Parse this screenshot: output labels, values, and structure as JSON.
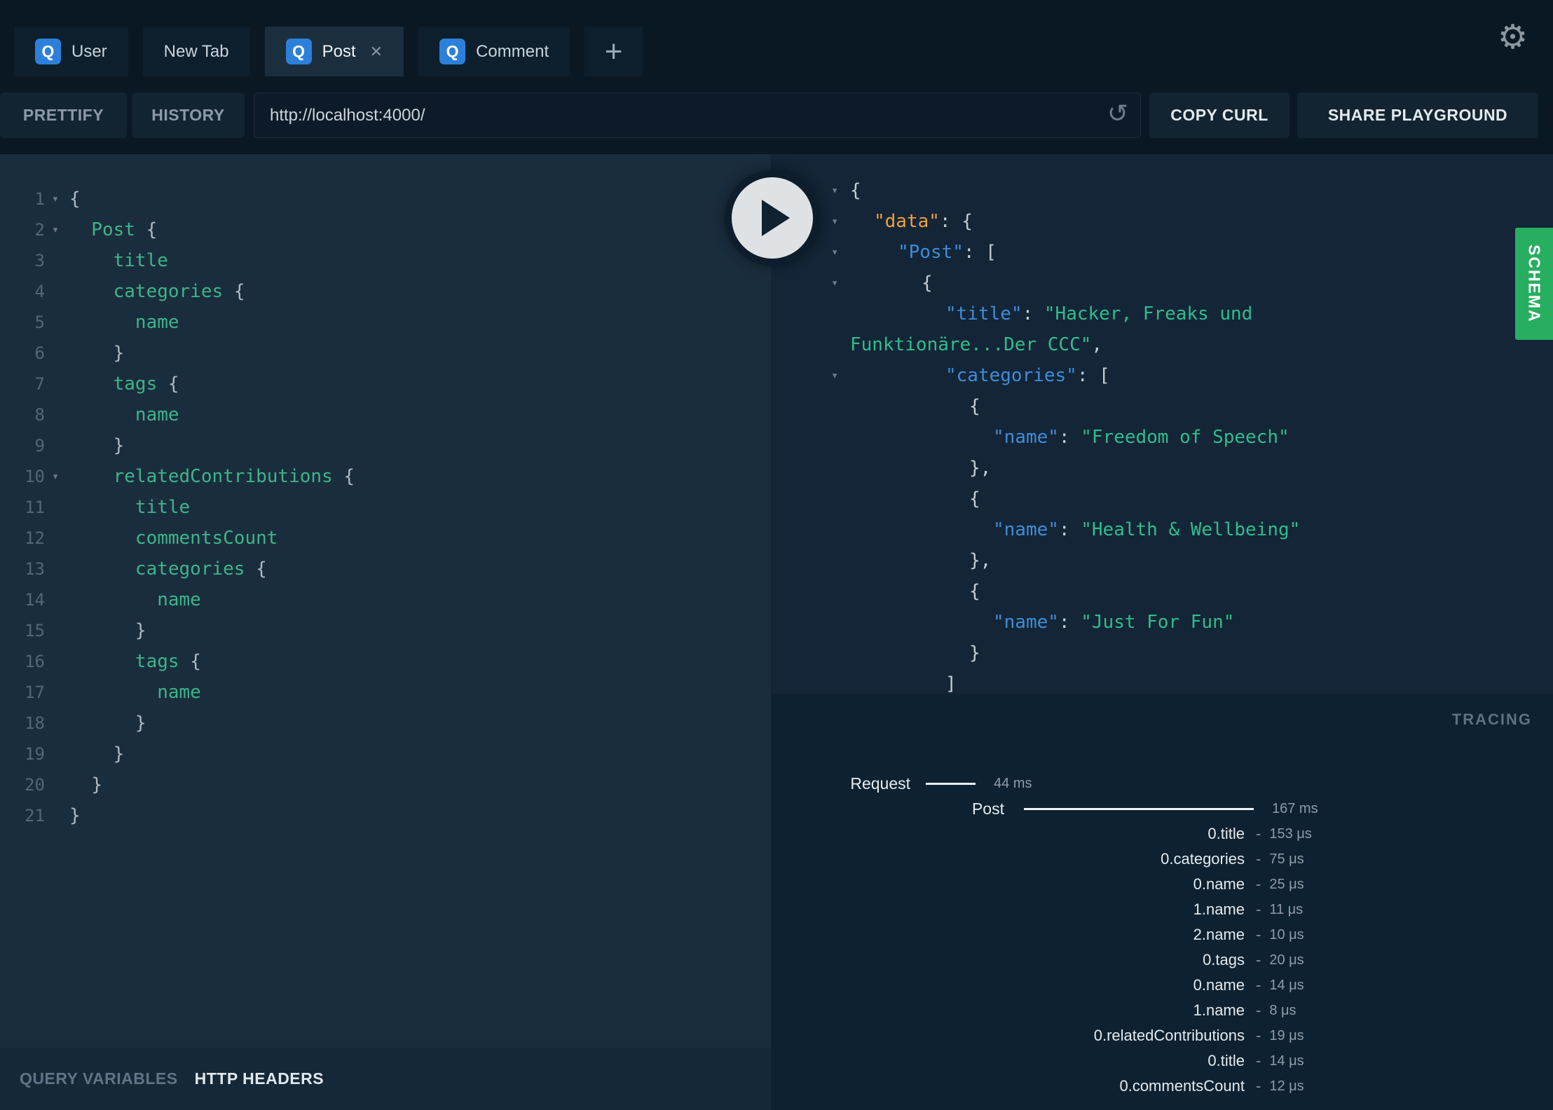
{
  "icons": {
    "gear": "⚙",
    "reload": "↺",
    "close": "✕",
    "collapse": "▾",
    "query_badge": "Q"
  },
  "tabs": [
    {
      "label": "User",
      "has_icon": true,
      "active": false,
      "closable": false
    },
    {
      "label": "New Tab",
      "has_icon": false,
      "active": false,
      "closable": false
    },
    {
      "label": "Post",
      "has_icon": true,
      "active": true,
      "closable": true
    },
    {
      "label": "Comment",
      "has_icon": true,
      "active": false,
      "closable": false
    }
  ],
  "new_tab_button": "+",
  "toolbar": {
    "prettify": "PRETTIFY",
    "history": "HISTORY",
    "url": "http://localhost:4000/",
    "copy_curl": "COPY CURL",
    "share": "SHARE PLAYGROUND"
  },
  "editor": {
    "lines": [
      {
        "n": 1,
        "arrow": true,
        "code": "{"
      },
      {
        "n": 2,
        "arrow": true,
        "code": "  Post {"
      },
      {
        "n": 3,
        "arrow": false,
        "code": "    title"
      },
      {
        "n": 4,
        "arrow": false,
        "code": "    categories {"
      },
      {
        "n": 5,
        "arrow": false,
        "code": "      name"
      },
      {
        "n": 6,
        "arrow": false,
        "code": "    }"
      },
      {
        "n": 7,
        "arrow": false,
        "code": "    tags {"
      },
      {
        "n": 8,
        "arrow": false,
        "code": "      name"
      },
      {
        "n": 9,
        "arrow": false,
        "code": "    }"
      },
      {
        "n": 10,
        "arrow": true,
        "code": "    relatedContributions {"
      },
      {
        "n": 11,
        "arrow": false,
        "code": "      title"
      },
      {
        "n": 12,
        "arrow": false,
        "code": "      commentsCount"
      },
      {
        "n": 13,
        "arrow": false,
        "code": "      categories {"
      },
      {
        "n": 14,
        "arrow": false,
        "code": "        name"
      },
      {
        "n": 15,
        "arrow": false,
        "code": "      }"
      },
      {
        "n": 16,
        "arrow": false,
        "code": "      tags {"
      },
      {
        "n": 17,
        "arrow": false,
        "code": "        name"
      },
      {
        "n": 18,
        "arrow": false,
        "code": "      }"
      },
      {
        "n": 19,
        "arrow": false,
        "code": "    }"
      },
      {
        "n": 20,
        "arrow": false,
        "code": "  }"
      },
      {
        "n": 21,
        "arrow": false,
        "code": "}"
      }
    ]
  },
  "response": {
    "lines": [
      {
        "arrow": true,
        "level": 0,
        "segs": [
          {
            "c": "p",
            "t": "{"
          }
        ]
      },
      {
        "arrow": true,
        "level": 1,
        "segs": [
          {
            "c": "kd",
            "t": "\"data\""
          },
          {
            "c": "p",
            "t": ": {"
          }
        ]
      },
      {
        "arrow": true,
        "level": 2,
        "segs": [
          {
            "c": "k",
            "t": "\"Post\""
          },
          {
            "c": "p",
            "t": ": ["
          }
        ]
      },
      {
        "arrow": true,
        "level": 3,
        "segs": [
          {
            "c": "p",
            "t": "{"
          }
        ]
      },
      {
        "arrow": false,
        "level": 4,
        "segs": [
          {
            "c": "k",
            "t": "\"title\""
          },
          {
            "c": "p",
            "t": ": "
          },
          {
            "c": "v",
            "t": "\"Hacker, Freaks und"
          }
        ]
      },
      {
        "arrow": false,
        "level": 0,
        "segs": [
          {
            "c": "v",
            "t": "Funktionäre...Der CCC\""
          },
          {
            "c": "p",
            "t": ","
          }
        ]
      },
      {
        "arrow": true,
        "level": 4,
        "segs": [
          {
            "c": "k",
            "t": "\"categories\""
          },
          {
            "c": "p",
            "t": ": ["
          }
        ]
      },
      {
        "arrow": false,
        "level": 5,
        "segs": [
          {
            "c": "p",
            "t": "{"
          }
        ]
      },
      {
        "arrow": false,
        "level": 6,
        "segs": [
          {
            "c": "k",
            "t": "\"name\""
          },
          {
            "c": "p",
            "t": ": "
          },
          {
            "c": "v",
            "t": "\"Freedom of Speech\""
          }
        ]
      },
      {
        "arrow": false,
        "level": 5,
        "segs": [
          {
            "c": "p",
            "t": "},"
          }
        ]
      },
      {
        "arrow": false,
        "level": 5,
        "segs": [
          {
            "c": "p",
            "t": "{"
          }
        ]
      },
      {
        "arrow": false,
        "level": 6,
        "segs": [
          {
            "c": "k",
            "t": "\"name\""
          },
          {
            "c": "p",
            "t": ": "
          },
          {
            "c": "v",
            "t": "\"Health & Wellbeing\""
          }
        ]
      },
      {
        "arrow": false,
        "level": 5,
        "segs": [
          {
            "c": "p",
            "t": "},"
          }
        ]
      },
      {
        "arrow": false,
        "level": 5,
        "segs": [
          {
            "c": "p",
            "t": "{"
          }
        ]
      },
      {
        "arrow": false,
        "level": 6,
        "segs": [
          {
            "c": "k",
            "t": "\"name\""
          },
          {
            "c": "p",
            "t": ": "
          },
          {
            "c": "v",
            "t": "\"Just For Fun\""
          }
        ]
      },
      {
        "arrow": false,
        "level": 5,
        "segs": [
          {
            "c": "p",
            "t": "}"
          }
        ]
      },
      {
        "arrow": false,
        "level": 4,
        "segs": [
          {
            "c": "p",
            "t": "]"
          }
        ]
      }
    ]
  },
  "schema_tab": "SCHEMA",
  "tracing": {
    "title": "TRACING",
    "rows": [
      {
        "kind": "bar",
        "label": "Request",
        "label_width": 199,
        "line_gap": 22,
        "line_width": 71,
        "value": "44 ms"
      },
      {
        "kind": "bar",
        "label": "Post",
        "label_width": 333,
        "line_gap": 28,
        "line_width": 328,
        "value": "167 ms"
      },
      {
        "kind": "leaf",
        "label": "0.title",
        "value": "153 μs"
      },
      {
        "kind": "leaf",
        "label": "0.categories",
        "value": "75 μs"
      },
      {
        "kind": "leaf",
        "label": "0.name",
        "value": "25 μs"
      },
      {
        "kind": "leaf",
        "label": "1.name",
        "value": "11 μs"
      },
      {
        "kind": "leaf",
        "label": "2.name",
        "value": "10 μs"
      },
      {
        "kind": "leaf",
        "label": "0.tags",
        "value": "20 μs"
      },
      {
        "kind": "leaf",
        "label": "0.name",
        "value": "14 μs"
      },
      {
        "kind": "leaf",
        "label": "1.name",
        "value": "8 μs"
      },
      {
        "kind": "leaf",
        "label": "0.relatedContributions",
        "value": "19 μs"
      },
      {
        "kind": "leaf",
        "label": "0.title",
        "value": "14 μs"
      },
      {
        "kind": "leaf",
        "label": "0.commentsCount",
        "value": "12 μs"
      }
    ]
  },
  "footer": {
    "query_variables": "QUERY VARIABLES",
    "http_headers": "HTTP HEADERS"
  }
}
